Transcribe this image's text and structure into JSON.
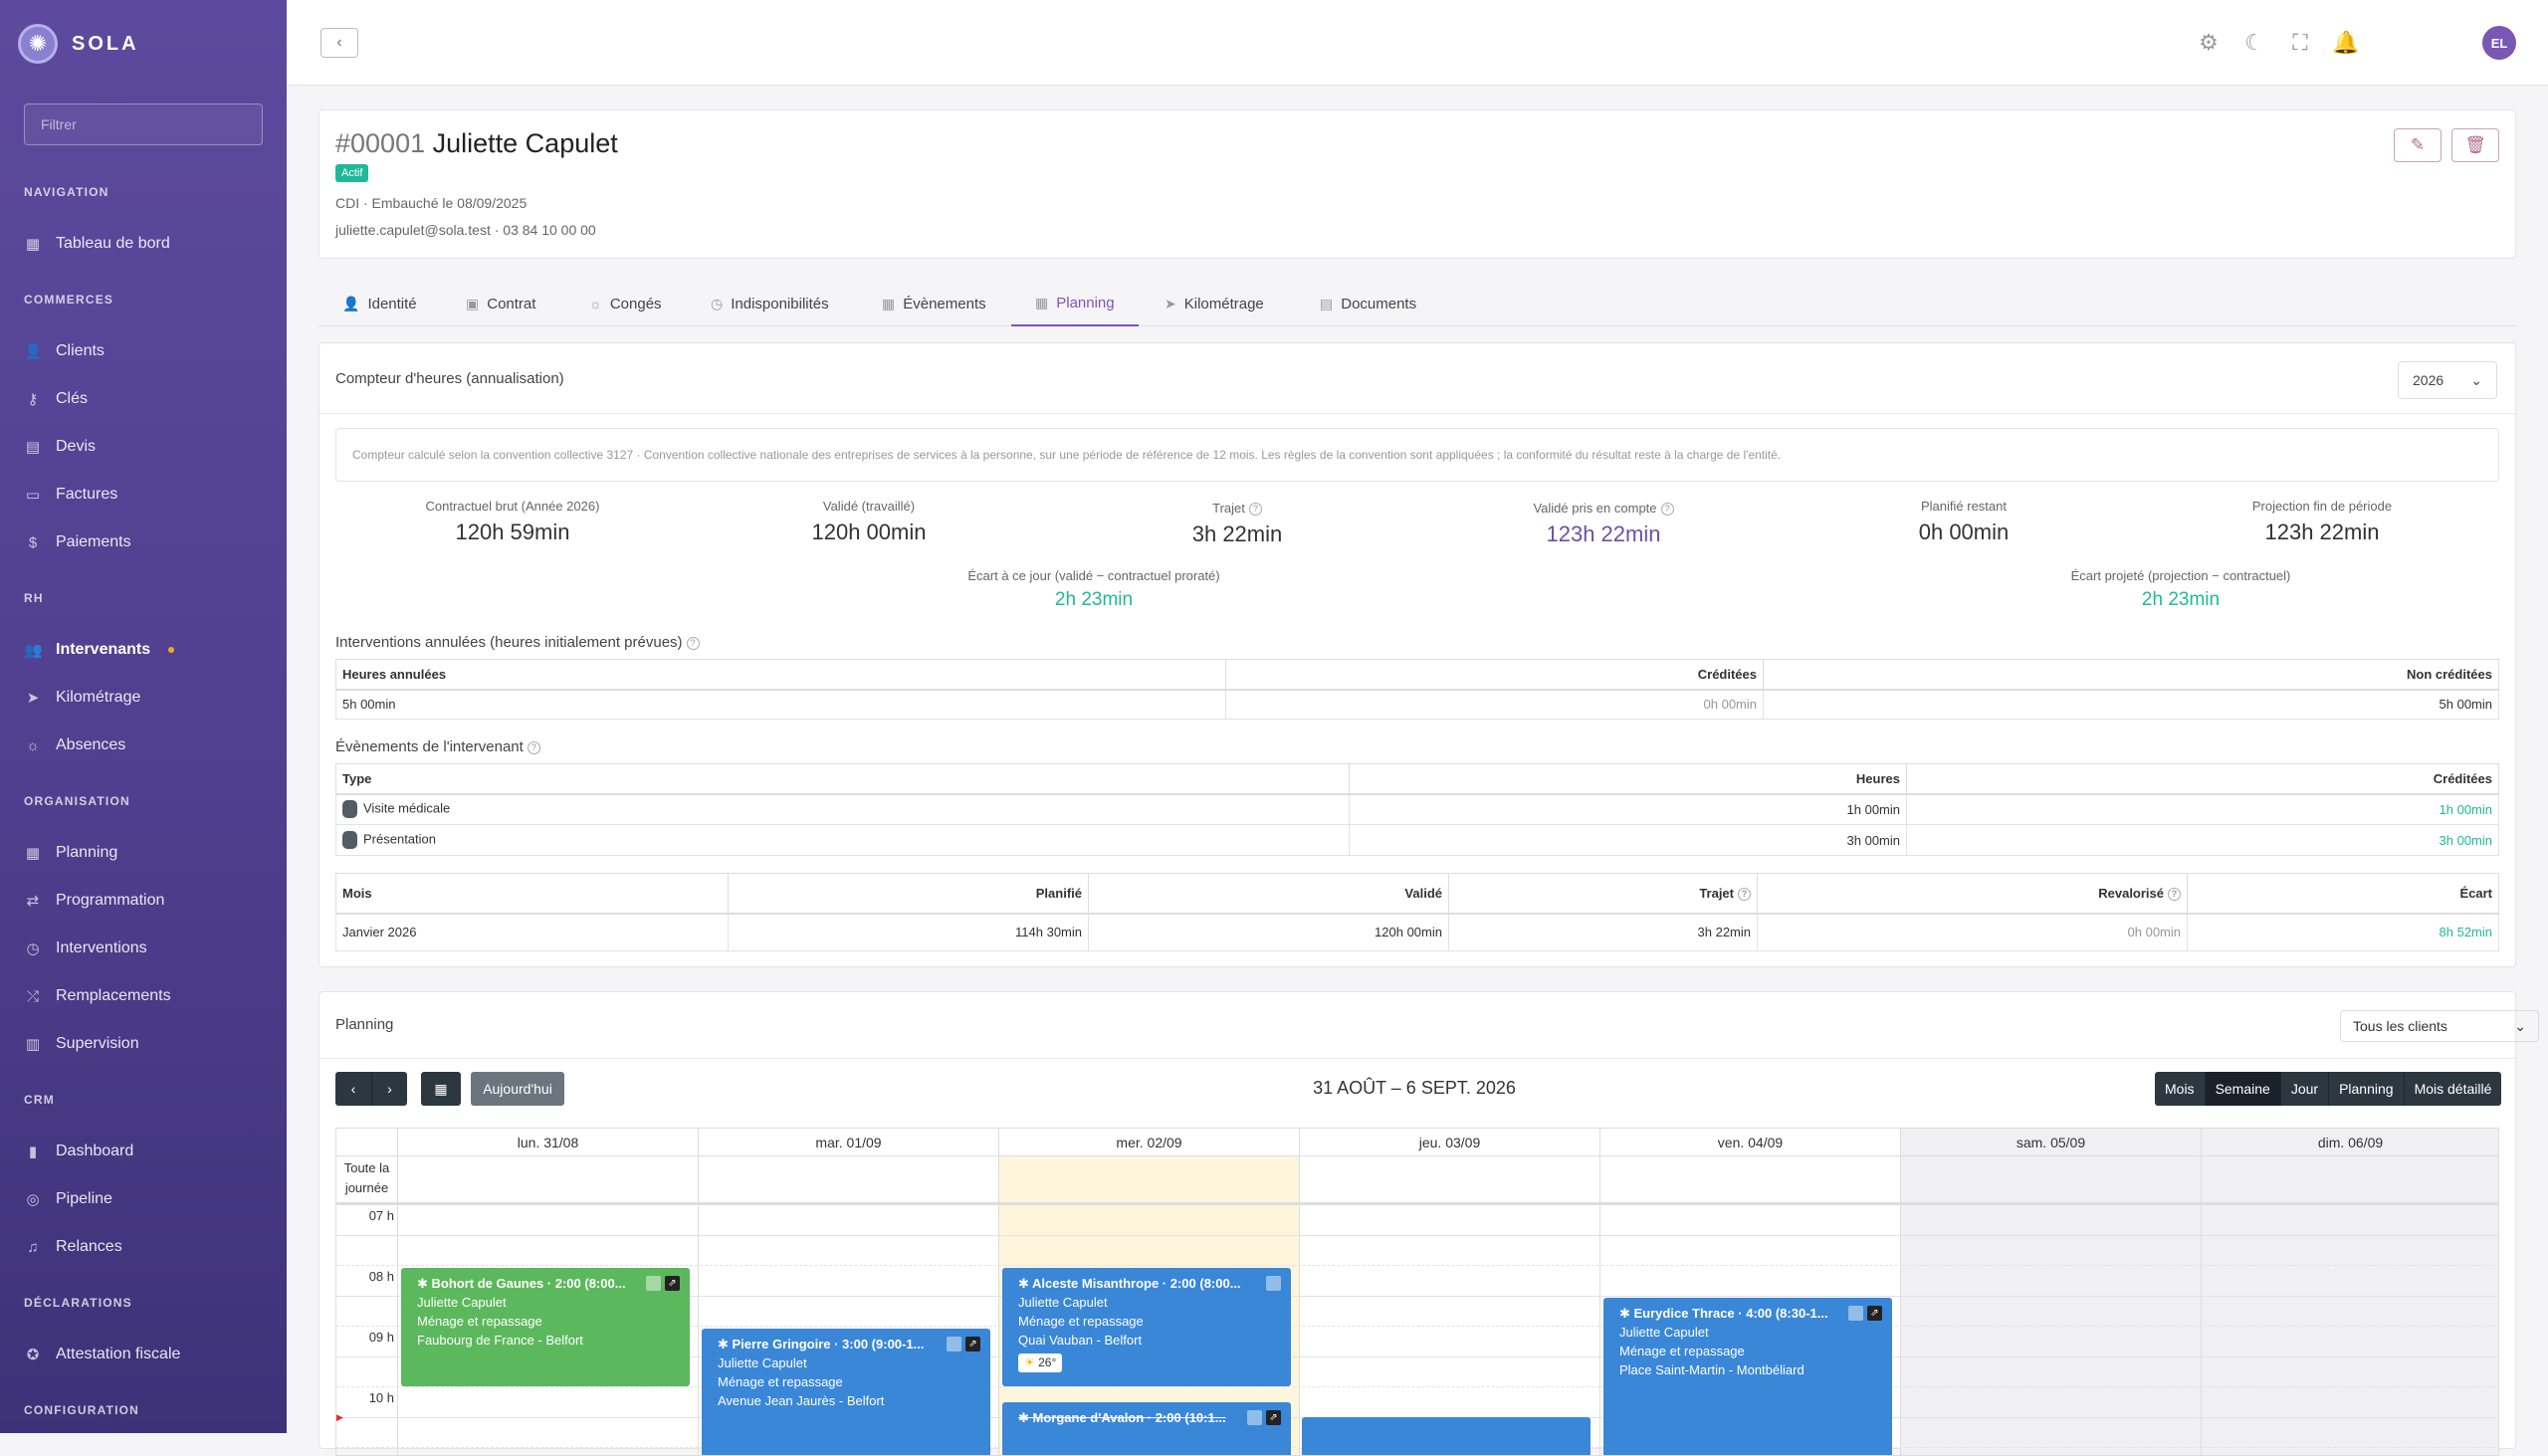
{
  "app": {
    "name": "SOLA",
    "filter_placeholder": "Filtrer"
  },
  "sidebar": {
    "sections": [
      {
        "title": "NAVIGATION",
        "items": [
          {
            "label": "Tableau de bord",
            "icon": "dashboard-icon"
          }
        ]
      },
      {
        "title": "COMMERCES",
        "items": [
          {
            "label": "Clients",
            "icon": "user-icon"
          },
          {
            "label": "Clés",
            "icon": "key-icon"
          },
          {
            "label": "Devis",
            "icon": "file-icon"
          },
          {
            "label": "Factures",
            "icon": "invoice-icon"
          },
          {
            "label": "Paiements",
            "icon": "dollar-icon"
          }
        ]
      },
      {
        "title": "RH",
        "items": [
          {
            "label": "Intervenants",
            "icon": "users-icon"
          },
          {
            "label": "Kilométrage",
            "icon": "send-icon"
          },
          {
            "label": "Absences",
            "icon": "sun-icon"
          }
        ]
      },
      {
        "title": "ORGANISATION",
        "items": [
          {
            "label": "Planning",
            "icon": "calendar-icon"
          },
          {
            "label": "Programmation",
            "icon": "repeat-icon"
          },
          {
            "label": "Interventions",
            "icon": "clock-icon"
          },
          {
            "label": "Remplacements",
            "icon": "shuffle-icon"
          },
          {
            "label": "Supervision",
            "icon": "map-icon"
          }
        ]
      },
      {
        "title": "CRM",
        "items": [
          {
            "label": "Dashboard",
            "icon": "chart-icon"
          },
          {
            "label": "Pipeline",
            "icon": "target-icon"
          },
          {
            "label": "Relances",
            "icon": "bell-icon"
          }
        ]
      },
      {
        "title": "DÉCLARATIONS",
        "items": [
          {
            "label": "Attestation fiscale",
            "icon": "award-icon"
          }
        ]
      },
      {
        "title": "CONFIGURATION",
        "items": []
      }
    ]
  },
  "topbar": {
    "avatar_initials": "EL"
  },
  "employee": {
    "number": "#00001",
    "name": "Juliette Capulet",
    "status": "Actif",
    "contract_line": "CDI · Embauché le 08/09/2025",
    "contact_line": "juliette.capulet@sola.test · 03 84 10 00 00"
  },
  "tabs": [
    {
      "label": "Identité",
      "icon": "user-icon"
    },
    {
      "label": "Contrat",
      "icon": "briefcase-icon"
    },
    {
      "label": "Congés",
      "icon": "sun-icon"
    },
    {
      "label": "Indisponibilités",
      "icon": "clock-icon"
    },
    {
      "label": "Évènements",
      "icon": "calendar-icon"
    },
    {
      "label": "Planning",
      "icon": "calendar-icon"
    },
    {
      "label": "Kilométrage",
      "icon": "send-icon"
    },
    {
      "label": "Documents",
      "icon": "file-icon"
    }
  ],
  "counter": {
    "title": "Compteur d'heures (annualisation)",
    "year": "2026",
    "notice": "Compteur calculé selon la convention collective 3127 · Convention collective nationale des entreprises de services à la personne, sur une période de référence de 12 mois. Les règles de la convention sont appliquées ; la conformité du résultat reste à la charge de l'entité.",
    "stats": [
      {
        "label": "Contractuel brut (Année 2026)",
        "value": "120h 59min"
      },
      {
        "label": "Validé (travaillé)",
        "value": "120h 00min"
      },
      {
        "label": "Trajet",
        "value": "3h 22min"
      },
      {
        "label": "Validé pris en compte",
        "value": "123h 22min"
      },
      {
        "label": "Planifié restant",
        "value": "0h 00min"
      },
      {
        "label": "Projection fin de période",
        "value": "123h 22min"
      }
    ],
    "gaps": [
      {
        "label": "Écart à ce jour (validé − contractuel proraté)",
        "value": "2h 23min"
      },
      {
        "label": "Écart projeté (projection − contractuel)",
        "value": "2h 23min"
      }
    ],
    "cancelled": {
      "title": "Interventions annulées (heures initialement prévues)",
      "headers": [
        "Heures annulées",
        "Créditées",
        "Non créditées"
      ],
      "row": [
        "5h 00min",
        "0h 00min",
        "5h 00min"
      ]
    },
    "events": {
      "title": "Évènements de l'intervenant",
      "headers": [
        "Type",
        "Heures",
        "Créditées"
      ],
      "rows": [
        [
          "Visite médicale",
          "1h 00min",
          "1h 00min"
        ],
        [
          "Présentation",
          "3h 00min",
          "3h 00min"
        ]
      ]
    },
    "monthly": {
      "headers": [
        "Mois",
        "Planifié",
        "Validé",
        "Trajet",
        "Revalorisé",
        "Écart"
      ],
      "rows": [
        [
          "Janvier 2026",
          "114h 30min",
          "120h 00min",
          "3h 22min",
          "0h 00min",
          "8h 52min"
        ]
      ]
    }
  },
  "planning": {
    "title": "Planning",
    "client_filter": "Tous les clients",
    "today_label": "Aujourd'hui",
    "range": "31 AOÛT – 6 SEPT. 2026",
    "views": [
      "Mois",
      "Semaine",
      "Jour",
      "Planning",
      "Mois détaillé"
    ],
    "active_view": "Semaine",
    "allday_label": "Toute la journée",
    "days": [
      "lun. 31/08",
      "mar. 01/09",
      "mer. 02/09",
      "jeu. 03/09",
      "ven. 04/09",
      "sam. 05/09",
      "dim. 06/09"
    ],
    "hours": [
      "07 h",
      "08 h",
      "09 h",
      "10 h"
    ],
    "events": [
      {
        "title": "Bohort de Gaunes · 2:00 (8:00...",
        "person": "Juliette Capulet",
        "service": "Ménage et repassage",
        "place": "Faubourg de France - Belfort",
        "color": "#5cb85c"
      },
      {
        "title": "Pierre Gringoire · 3:00 (9:00-1...",
        "person": "Juliette Capulet",
        "service": "Ménage et repassage",
        "place": "Avenue Jean Jaurès - Belfort",
        "color": "#3a87d8"
      },
      {
        "title": "Alceste Misanthrope · 2:00 (8:00...",
        "person": "Juliette Capulet",
        "service": "Ménage et repassage",
        "place": "Quai Vauban - Belfort",
        "weather": "26°",
        "color": "#3a87d8"
      },
      {
        "title": "Morgane d'Avalon · 2:00 (10:1...",
        "color": "#3a87d8"
      },
      {
        "title": "Eurydice Thrace · 4:00 (8:30-1...",
        "person": "Juliette Capulet",
        "service": "Ménage et repassage",
        "place": "Place Saint-Martin - Montbéliard",
        "color": "#3a87d8"
      }
    ]
  }
}
